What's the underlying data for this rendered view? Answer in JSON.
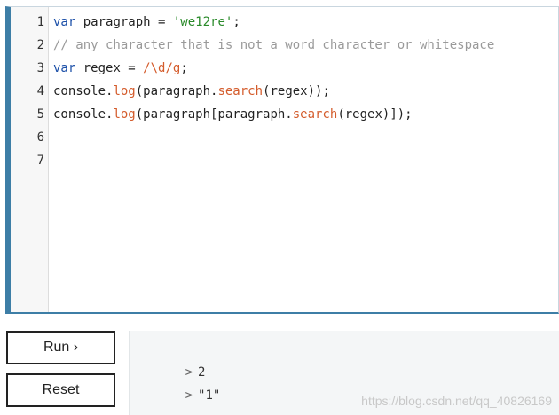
{
  "editor": {
    "line_numbers": [
      "1",
      "2",
      "3",
      "4",
      "5",
      "6",
      "7"
    ],
    "lines": [
      [
        {
          "t": "var",
          "c": "kw"
        },
        {
          "t": " paragraph = ",
          "c": ""
        },
        {
          "t": "'we12re'",
          "c": "str"
        },
        {
          "t": ";",
          "c": ""
        }
      ],
      [
        {
          "t": "// any character that is not a word character or whitespace",
          "c": "cmt"
        }
      ],
      [
        {
          "t": "var",
          "c": "kw"
        },
        {
          "t": " regex = ",
          "c": ""
        },
        {
          "t": "/\\d/g",
          "c": "re"
        },
        {
          "t": ";",
          "c": ""
        }
      ],
      [
        {
          "t": "console.",
          "c": ""
        },
        {
          "t": "log",
          "c": "fn"
        },
        {
          "t": "(paragraph.",
          "c": ""
        },
        {
          "t": "search",
          "c": "fn"
        },
        {
          "t": "(regex));",
          "c": ""
        }
      ],
      [
        {
          "t": "console.",
          "c": ""
        },
        {
          "t": "log",
          "c": "fn"
        },
        {
          "t": "(paragraph[paragraph.",
          "c": ""
        },
        {
          "t": "search",
          "c": "fn"
        },
        {
          "t": "(regex)]);",
          "c": ""
        }
      ],
      [],
      []
    ]
  },
  "buttons": {
    "run_label": "Run ›",
    "reset_label": "Reset"
  },
  "console": {
    "prompt_symbol": ">",
    "outputs": [
      "2",
      "\"1\""
    ]
  },
  "watermark": "https://blog.csdn.net/qq_40826169",
  "colors": {
    "accent_border": "#3d7ea6",
    "keyword": "#1b4fa8",
    "string": "#2a8a2a",
    "comment": "#9a9a9a",
    "function": "#d45c2c"
  }
}
